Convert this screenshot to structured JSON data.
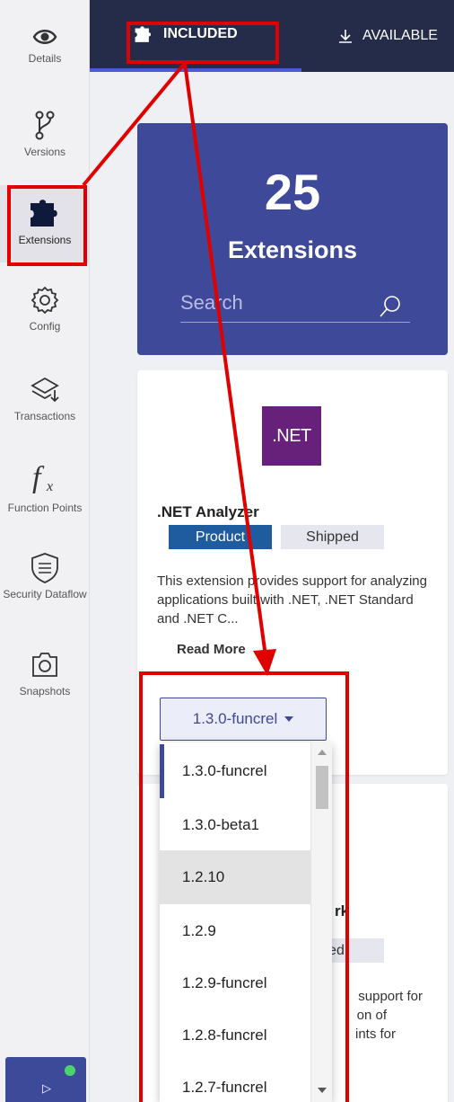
{
  "sidebar": {
    "items": [
      {
        "label": "Details",
        "icon": "eye-icon"
      },
      {
        "label": "Versions",
        "icon": "branch-icon"
      },
      {
        "label": "Extensions",
        "icon": "puzzle-icon"
      },
      {
        "label": "Config",
        "icon": "gear-icon"
      },
      {
        "label": "Transactions",
        "icon": "layers-icon"
      },
      {
        "label": "Function Points",
        "icon": "function-icon"
      },
      {
        "label": "Security Dataflow",
        "icon": "shield-icon"
      },
      {
        "label": "Snapshots",
        "icon": "camera-icon"
      }
    ],
    "active": "Extensions",
    "bottom_icon": "play-icon",
    "status_color": "#4bd469"
  },
  "tabs": {
    "included": "INCLUDED",
    "available": "AVAILABLE"
  },
  "summary": {
    "count": "25",
    "label": "Extensions",
    "search_placeholder": "Search"
  },
  "extension": {
    "logo_text": ".NET",
    "name": ".NET Analyzer",
    "badges": [
      "Product",
      "Shipped"
    ],
    "description": "This extension provides support for analyzing applications built with .NET, .NET Standard and .NET C...",
    "read_more": "Read More",
    "selected_version": "1.3.0-funcrel"
  },
  "extension2": {
    "title_fragment": "rk",
    "badge_fragment": "ped",
    "desc_fragment_1": "support for",
    "desc_fragment_2": "on of",
    "desc_fragment_3": "ints for"
  },
  "dropdown": {
    "options": [
      "1.3.0-funcrel",
      "1.3.0-beta1",
      "1.2.10",
      "1.2.9",
      "1.2.9-funcrel",
      "1.2.8-funcrel",
      "1.2.7-funcrel"
    ],
    "selected_index": 0,
    "hover_index": 2
  },
  "colors": {
    "topbar": "#252c49",
    "accent": "#3f4999",
    "annotation": "#e00000"
  }
}
